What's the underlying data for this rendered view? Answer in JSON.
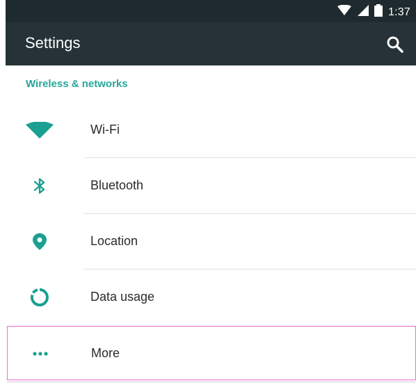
{
  "status_bar": {
    "time": "1:37",
    "icons": [
      "wifi-icon",
      "signal-icon",
      "battery-icon"
    ]
  },
  "app_bar": {
    "title": "Settings",
    "actions": [
      "search-icon"
    ]
  },
  "section": {
    "title": "Wireless & networks"
  },
  "items": [
    {
      "label": "Wi-Fi",
      "icon": "wifi-icon"
    },
    {
      "label": "Bluetooth",
      "icon": "bluetooth-icon"
    },
    {
      "label": "Location",
      "icon": "location-pin-icon"
    },
    {
      "label": "Data usage",
      "icon": "data-usage-icon"
    },
    {
      "label": "More",
      "icon": "more-horizontal-icon"
    }
  ],
  "colors": {
    "accent": "#26a69a",
    "app_bar": "#263238",
    "status_bar": "#1e2a2e",
    "highlight": "#f06ad0"
  }
}
